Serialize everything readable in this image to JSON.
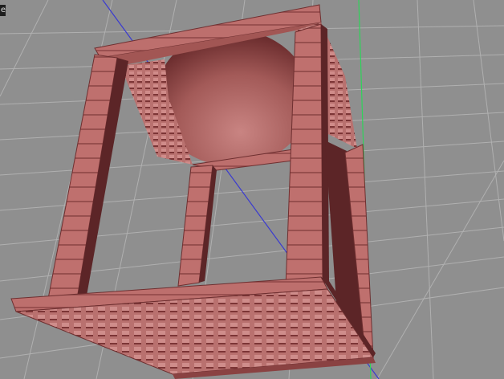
{
  "viewport": {
    "label": "e",
    "colors": {
      "background": "#8f8f8f",
      "grid": "#b4b4b4",
      "model": "#b56a68",
      "model_dark": "#5c2527",
      "model_light": "#d08a88",
      "axis_blue": "#3a3ad0",
      "axis_green": "#2fd35a",
      "sphere": "#a8605e"
    }
  }
}
